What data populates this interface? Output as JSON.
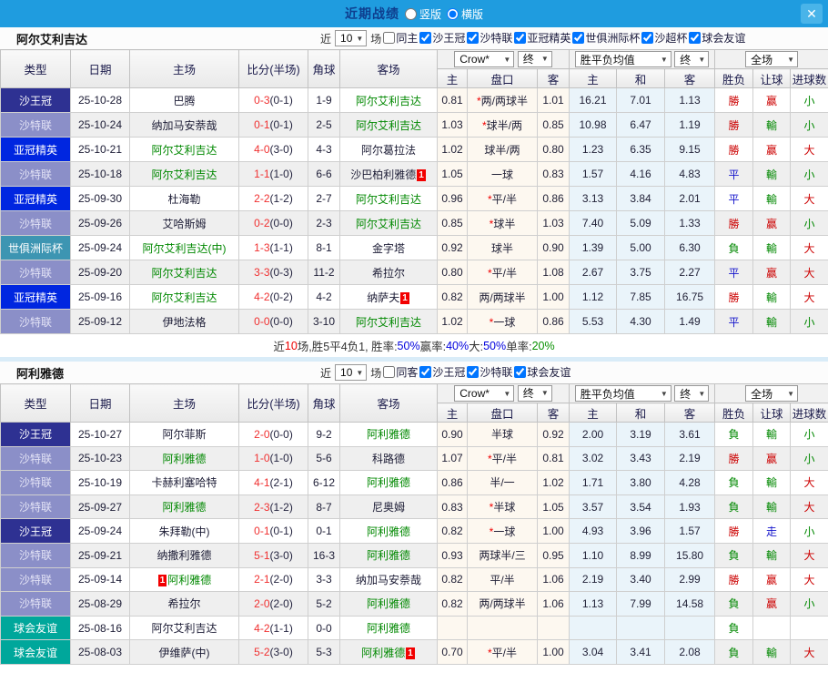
{
  "titlebar": {
    "title": "近期战绩",
    "view_options": [
      {
        "label": "竖版",
        "selected": false
      },
      {
        "label": "横版",
        "selected": true
      }
    ],
    "close_icon": "✕"
  },
  "colors": {
    "topbar_bg": "#1f9cdf",
    "title_text": "#0e3e8e",
    "focus_team_green": "#008800",
    "score_red": "#f03030",
    "result_red": "#cc0000",
    "result_blue": "#1515cc",
    "result_green": "#008800",
    "odds_cell_bg": "#fdf8f0",
    "avg_cell_bg": "#eaf4fa"
  },
  "type_colors": {
    "沙王冠": {
      "bg": "#2e3192",
      "fg": "#ffffff"
    },
    "沙特联": {
      "bg": "#8b8fc8",
      "fg": "#e4e4f6"
    },
    "亚冠精英": {
      "bg": "#0026e0",
      "fg": "#ffffff"
    },
    "世俱洲际杯": {
      "bg": "#3d95b2",
      "fg": "#ffffff"
    },
    "球会友谊": {
      "bg": "#00a79b",
      "fg": "#ffffff"
    }
  },
  "result_colors": {
    "勝": "red",
    "赢": "red",
    "大": "red",
    "平": "blue",
    "走": "blue",
    "負": "green",
    "輸": "green",
    "小": "green"
  },
  "table_header": {
    "type": "类型",
    "date": "日期",
    "home": "主场",
    "score": "比分(半场)",
    "corner": "角球",
    "away": "客场",
    "odds_group": {
      "select1": "Crow*",
      "select2": "终",
      "home": "主",
      "handicap": "盘口",
      "away": "客"
    },
    "avg_group": {
      "select1": "胜平负均值",
      "select2": "终",
      "home": "主",
      "draw": "和",
      "away": "客"
    },
    "full_group": {
      "select": "全场",
      "wdl": "胜负",
      "handicap": "让球",
      "goals": "进球数"
    }
  },
  "sections": [
    {
      "team": "阿尔艾利吉达",
      "filter": {
        "prefix": "近",
        "count": "10",
        "suffix": "场",
        "checkboxes": [
          {
            "label": "同主",
            "checked": false
          },
          {
            "label": "沙王冠",
            "checked": true
          },
          {
            "label": "沙特联",
            "checked": true
          },
          {
            "label": "亚冠精英",
            "checked": true
          },
          {
            "label": "世俱洲际杯",
            "checked": true
          },
          {
            "label": "沙超杯",
            "checked": true
          },
          {
            "label": "球会友谊",
            "checked": true
          }
        ]
      },
      "rows": [
        {
          "type": "沙王冠",
          "date": "25-10-28",
          "home": {
            "name": "巴腾",
            "green": false
          },
          "score": {
            "full": "0-3",
            "half": "(0-1)"
          },
          "corner": "1-9",
          "away": {
            "name": "阿尔艾利吉达",
            "green": true
          },
          "odds": [
            "0.81",
            "*两/两球半",
            "1.01"
          ],
          "avg": [
            "16.21",
            "7.01",
            "1.13"
          ],
          "results": [
            "勝",
            "赢",
            "小"
          ]
        },
        {
          "type": "沙特联",
          "date": "25-10-24",
          "home": {
            "name": "纳加马安萘哉",
            "green": false
          },
          "score": {
            "full": "0-1",
            "half": "(0-1)"
          },
          "corner": "2-5",
          "away": {
            "name": "阿尔艾利吉达",
            "green": true
          },
          "odds": [
            "1.03",
            "*球半/两",
            "0.85"
          ],
          "avg": [
            "10.98",
            "6.47",
            "1.19"
          ],
          "results": [
            "勝",
            "輸",
            "小"
          ]
        },
        {
          "type": "亚冠精英",
          "date": "25-10-21",
          "home": {
            "name": "阿尔艾利吉达",
            "green": true
          },
          "score": {
            "full": "4-0",
            "half": "(3-0)"
          },
          "corner": "4-3",
          "away": {
            "name": "阿尔葛拉法",
            "green": false
          },
          "odds": [
            "1.02",
            "球半/两",
            "0.80"
          ],
          "avg": [
            "1.23",
            "6.35",
            "9.15"
          ],
          "results": [
            "勝",
            "赢",
            "大"
          ]
        },
        {
          "type": "沙特联",
          "date": "25-10-18",
          "home": {
            "name": "阿尔艾利吉达",
            "green": true
          },
          "score": {
            "full": "1-1",
            "half": "(1-0)"
          },
          "corner": "6-6",
          "away": {
            "name": "沙巴柏利雅德",
            "green": false,
            "badge": "1",
            "badge_pos": "after"
          },
          "odds": [
            "1.05",
            "一球",
            "0.83"
          ],
          "avg": [
            "1.57",
            "4.16",
            "4.83"
          ],
          "results": [
            "平",
            "輸",
            "小"
          ]
        },
        {
          "type": "亚冠精英",
          "date": "25-09-30",
          "home": {
            "name": "杜海勒",
            "green": false
          },
          "score": {
            "full": "2-2",
            "half": "(1-2)"
          },
          "corner": "2-7",
          "away": {
            "name": "阿尔艾利吉达",
            "green": true
          },
          "odds": [
            "0.96",
            "*平/半",
            "0.86"
          ],
          "avg": [
            "3.13",
            "3.84",
            "2.01"
          ],
          "results": [
            "平",
            "輸",
            "大"
          ]
        },
        {
          "type": "沙特联",
          "date": "25-09-26",
          "home": {
            "name": "艾哈斯姆",
            "green": false
          },
          "score": {
            "full": "0-2",
            "half": "(0-0)"
          },
          "corner": "2-3",
          "away": {
            "name": "阿尔艾利吉达",
            "green": true
          },
          "odds": [
            "0.85",
            "*球半",
            "1.03"
          ],
          "avg": [
            "7.40",
            "5.09",
            "1.33"
          ],
          "results": [
            "勝",
            "赢",
            "小"
          ]
        },
        {
          "type": "世俱洲际杯",
          "date": "25-09-24",
          "home": {
            "name": "阿尔艾利吉达(中)",
            "green": true
          },
          "score": {
            "full": "1-3",
            "half": "(1-1)"
          },
          "corner": "8-1",
          "away": {
            "name": "金字塔",
            "green": false
          },
          "odds": [
            "0.92",
            "球半",
            "0.90"
          ],
          "avg": [
            "1.39",
            "5.00",
            "6.30"
          ],
          "results": [
            "負",
            "輸",
            "大"
          ]
        },
        {
          "type": "沙特联",
          "date": "25-09-20",
          "home": {
            "name": "阿尔艾利吉达",
            "green": true
          },
          "score": {
            "full": "3-3",
            "half": "(0-3)"
          },
          "corner": "11-2",
          "away": {
            "name": "希拉尔",
            "green": false
          },
          "odds": [
            "0.80",
            "*平/半",
            "1.08"
          ],
          "avg": [
            "2.67",
            "3.75",
            "2.27"
          ],
          "results": [
            "平",
            "赢",
            "大"
          ]
        },
        {
          "type": "亚冠精英",
          "date": "25-09-16",
          "home": {
            "name": "阿尔艾利吉达",
            "green": true
          },
          "score": {
            "full": "4-2",
            "half": "(0-2)"
          },
          "corner": "4-2",
          "away": {
            "name": "纳萨夫",
            "green": false,
            "badge": "1",
            "badge_pos": "after"
          },
          "odds": [
            "0.82",
            "两/两球半",
            "1.00"
          ],
          "avg": [
            "1.12",
            "7.85",
            "16.75"
          ],
          "results": [
            "勝",
            "輸",
            "大"
          ]
        },
        {
          "type": "沙特联",
          "date": "25-09-12",
          "home": {
            "name": "伊地法格",
            "green": false
          },
          "score": {
            "full": "0-0",
            "half": "(0-0)"
          },
          "corner": "3-10",
          "away": {
            "name": "阿尔艾利吉达",
            "green": true
          },
          "odds": [
            "1.02",
            "*一球",
            "0.86"
          ],
          "avg": [
            "5.53",
            "4.30",
            "1.49"
          ],
          "results": [
            "平",
            "輸",
            "小"
          ]
        }
      ],
      "summary": [
        {
          "text": "近",
          "color": "dark"
        },
        {
          "text": "10",
          "color": "red"
        },
        {
          "text": "场,胜5平4负1, 胜率:",
          "color": "dark"
        },
        {
          "text": "50%",
          "color": "blue"
        },
        {
          "text": " 赢率:",
          "color": "dark"
        },
        {
          "text": "40%",
          "color": "blue"
        },
        {
          "text": " 大:",
          "color": "dark"
        },
        {
          "text": "50%",
          "color": "blue"
        },
        {
          "text": " 单率:",
          "color": "dark"
        },
        {
          "text": "20%",
          "color": "green"
        }
      ]
    },
    {
      "team": "阿利雅德",
      "filter": {
        "prefix": "近",
        "count": "10",
        "suffix": "场",
        "checkboxes": [
          {
            "label": "同客",
            "checked": false
          },
          {
            "label": "沙王冠",
            "checked": true
          },
          {
            "label": "沙特联",
            "checked": true
          },
          {
            "label": "球会友谊",
            "checked": true
          }
        ]
      },
      "rows": [
        {
          "type": "沙王冠",
          "date": "25-10-27",
          "home": {
            "name": "阿尔菲斯",
            "green": false
          },
          "score": {
            "full": "2-0",
            "half": "(0-0)"
          },
          "corner": "9-2",
          "away": {
            "name": "阿利雅德",
            "green": true
          },
          "odds": [
            "0.90",
            "半球",
            "0.92"
          ],
          "avg": [
            "2.00",
            "3.19",
            "3.61"
          ],
          "results": [
            "負",
            "輸",
            "小"
          ]
        },
        {
          "type": "沙特联",
          "date": "25-10-23",
          "home": {
            "name": "阿利雅德",
            "green": true
          },
          "score": {
            "full": "1-0",
            "half": "(1-0)"
          },
          "corner": "5-6",
          "away": {
            "name": "科路德",
            "green": false
          },
          "odds": [
            "1.07",
            "*平/半",
            "0.81"
          ],
          "avg": [
            "3.02",
            "3.43",
            "2.19"
          ],
          "results": [
            "勝",
            "赢",
            "小"
          ]
        },
        {
          "type": "沙特联",
          "date": "25-10-19",
          "home": {
            "name": "卡赫利塞哈特",
            "green": false
          },
          "score": {
            "full": "4-1",
            "half": "(2-1)"
          },
          "corner": "6-12",
          "away": {
            "name": "阿利雅德",
            "green": true
          },
          "odds": [
            "0.86",
            "半/一",
            "1.02"
          ],
          "avg": [
            "1.71",
            "3.80",
            "4.28"
          ],
          "results": [
            "負",
            "輸",
            "大"
          ]
        },
        {
          "type": "沙特联",
          "date": "25-09-27",
          "home": {
            "name": "阿利雅德",
            "green": true
          },
          "score": {
            "full": "2-3",
            "half": "(1-2)"
          },
          "corner": "8-7",
          "away": {
            "name": "尼奥姆",
            "green": false
          },
          "odds": [
            "0.83",
            "*半球",
            "1.05"
          ],
          "avg": [
            "3.57",
            "3.54",
            "1.93"
          ],
          "results": [
            "負",
            "輸",
            "大"
          ]
        },
        {
          "type": "沙王冠",
          "date": "25-09-24",
          "home": {
            "name": "朱拜勒(中)",
            "green": false
          },
          "score": {
            "full": "0-1",
            "half": "(0-1)"
          },
          "corner": "0-1",
          "away": {
            "name": "阿利雅德",
            "green": true
          },
          "odds": [
            "0.82",
            "*一球",
            "1.00"
          ],
          "avg": [
            "4.93",
            "3.96",
            "1.57"
          ],
          "results": [
            "勝",
            "走",
            "小"
          ]
        },
        {
          "type": "沙特联",
          "date": "25-09-21",
          "home": {
            "name": "纳撒利雅德",
            "green": false
          },
          "score": {
            "full": "5-1",
            "half": "(3-0)"
          },
          "corner": "16-3",
          "away": {
            "name": "阿利雅德",
            "green": true
          },
          "odds": [
            "0.93",
            "两球半/三",
            "0.95"
          ],
          "avg": [
            "1.10",
            "8.99",
            "15.80"
          ],
          "results": [
            "負",
            "輸",
            "大"
          ]
        },
        {
          "type": "沙特联",
          "date": "25-09-14",
          "home": {
            "name": "阿利雅德",
            "green": true,
            "badge": "1",
            "badge_pos": "before"
          },
          "score": {
            "full": "2-1",
            "half": "(2-0)"
          },
          "corner": "3-3",
          "away": {
            "name": "纳加马安萘哉",
            "green": false
          },
          "odds": [
            "0.82",
            "平/半",
            "1.06"
          ],
          "avg": [
            "2.19",
            "3.40",
            "2.99"
          ],
          "results": [
            "勝",
            "赢",
            "大"
          ]
        },
        {
          "type": "沙特联",
          "date": "25-08-29",
          "home": {
            "name": "希拉尔",
            "green": false
          },
          "score": {
            "full": "2-0",
            "half": "(2-0)"
          },
          "corner": "5-2",
          "away": {
            "name": "阿利雅德",
            "green": true
          },
          "odds": [
            "0.82",
            "两/两球半",
            "1.06"
          ],
          "avg": [
            "1.13",
            "7.99",
            "14.58"
          ],
          "results": [
            "負",
            "赢",
            "小"
          ]
        },
        {
          "type": "球会友谊",
          "date": "25-08-16",
          "home": {
            "name": "阿尔艾利吉达",
            "green": false
          },
          "score": {
            "full": "4-2",
            "half": "(1-1)"
          },
          "corner": "0-0",
          "away": {
            "name": "阿利雅德",
            "green": true
          },
          "odds": [
            "",
            "",
            ""
          ],
          "avg": [
            "",
            "",
            ""
          ],
          "results": [
            "負",
            "",
            ""
          ]
        },
        {
          "type": "球会友谊",
          "date": "25-08-03",
          "home": {
            "name": "伊维萨(中)",
            "green": false
          },
          "score": {
            "full": "5-2",
            "half": "(3-0)"
          },
          "corner": "5-3",
          "away": {
            "name": "阿利雅德",
            "green": true,
            "badge": "1",
            "badge_pos": "after"
          },
          "odds": [
            "0.70",
            "*平/半",
            "1.00"
          ],
          "avg": [
            "3.04",
            "3.41",
            "2.08"
          ],
          "results": [
            "負",
            "輸",
            "大"
          ]
        }
      ]
    }
  ]
}
